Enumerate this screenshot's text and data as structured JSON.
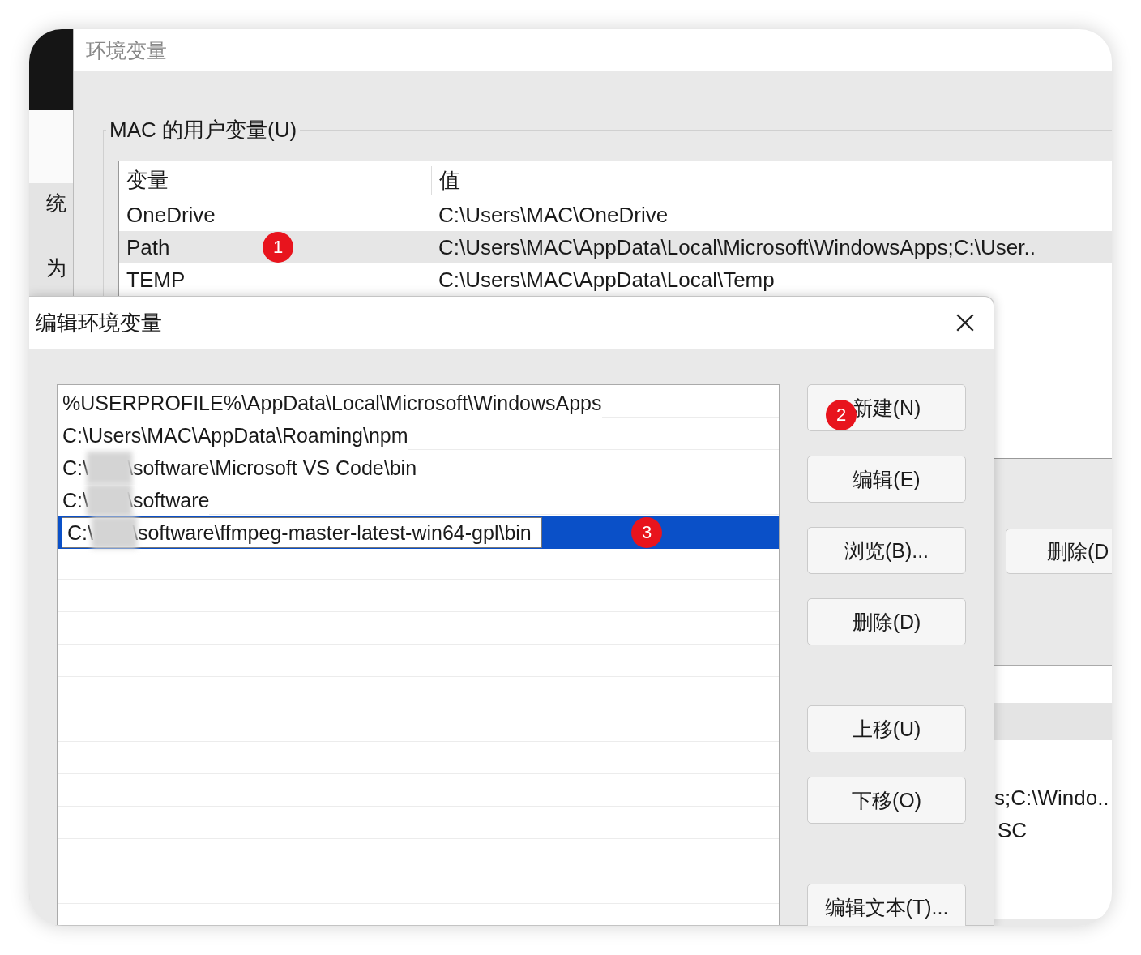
{
  "background_window": {
    "labels": [
      "统",
      "为"
    ]
  },
  "env_window": {
    "title": "环境变量",
    "group_label": "MAC 的用户变量(U)",
    "columns": [
      "变量",
      "值"
    ],
    "rows": [
      {
        "name": "OneDrive",
        "value": "C:\\Users\\MAC\\OneDrive",
        "selected": false
      },
      {
        "name": "Path",
        "value": "C:\\Users\\MAC\\AppData\\Local\\Microsoft\\WindowsApps;C:\\User..",
        "selected": true,
        "marker": "1"
      },
      {
        "name": "TEMP",
        "value": "C:\\Users\\MAC\\AppData\\Local\\Temp",
        "selected": false
      }
    ],
    "delete_button": "删除(D",
    "system_values": [
      "s;C:\\Windo..",
      "SC"
    ]
  },
  "dialog": {
    "title": "编辑环境变量",
    "items": [
      {
        "text": "%USERPROFILE%\\AppData\\Local\\Microsoft\\WindowsApps",
        "redacted": false,
        "selected": false
      },
      {
        "text": "C:\\Users\\MAC\\AppData\\Roaming\\npm",
        "redacted": false,
        "selected": false
      },
      {
        "prefix": "C:\\",
        "text": "\\software\\Microsoft VS Code\\bin",
        "redacted": true,
        "selected": false
      },
      {
        "prefix": "C:\\",
        "text": "\\software",
        "redacted": true,
        "selected": false
      },
      {
        "prefix": "C:\\",
        "text": "\\software\\ffmpeg-master-latest-win64-gpl\\bin",
        "redacted": true,
        "selected": true,
        "marker": "3"
      }
    ],
    "buttons": [
      {
        "label": "新建(N)",
        "marker": "2"
      },
      {
        "label": "编辑(E)"
      },
      {
        "label": "浏览(B)..."
      },
      {
        "label": "删除(D)"
      },
      {
        "label": "上移(U)"
      },
      {
        "label": "下移(O)"
      },
      {
        "label": "编辑文本(T)..."
      }
    ]
  }
}
